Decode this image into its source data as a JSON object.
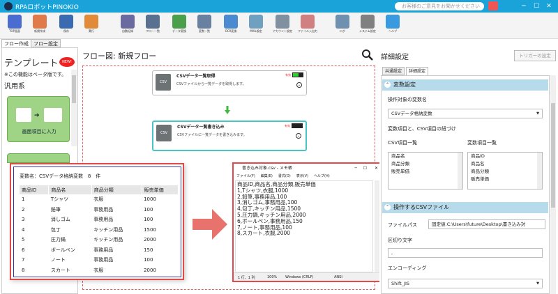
{
  "app": {
    "title": "RPAロボットPINOKIO",
    "feedback": "お客様のご意見をお聞かせください"
  },
  "toolbar": [
    {
      "label": "TOP画面",
      "icon": "home-icon",
      "color": "#4a6bd0"
    },
    {
      "label": "新規作成",
      "icon": "new-file-icon",
      "color": "#e07a4a"
    },
    {
      "label": "保存",
      "icon": "save-icon",
      "color": "#3a6ab0"
    },
    {
      "label": "実行",
      "icon": "run-icon",
      "color": "#e08a3a"
    },
    {
      "label": "自動記録",
      "icon": "record-icon",
      "color": "#6a6aa0"
    },
    {
      "label": "フロー一覧",
      "icon": "flow-list-icon",
      "color": "#5a7090"
    },
    {
      "label": "データ変換",
      "icon": "data-convert-icon",
      "color": "#4aa04a"
    },
    {
      "label": "変数一覧",
      "icon": "variable-list-icon",
      "color": "#6a80a0"
    },
    {
      "label": "OCR変換",
      "icon": "ocr-icon",
      "color": "#4a8ad0"
    },
    {
      "label": "MAIL設定",
      "icon": "mail-icon",
      "color": "#70a0c0"
    },
    {
      "label": "アカウント設定",
      "icon": "account-icon",
      "color": "#8090a0"
    },
    {
      "label": "ファイル入出力",
      "icon": "file-io-icon",
      "color": "#d08080"
    },
    {
      "label": "ログ",
      "icon": "log-icon",
      "color": "#7090b0"
    },
    {
      "label": "システム設定",
      "icon": "gear-icon",
      "color": "#808080"
    },
    {
      "label": "ヘルプ",
      "icon": "help-icon",
      "color": "#3a9ae0"
    }
  ],
  "tabs": [
    "フロー作成",
    "フロー設定"
  ],
  "left": {
    "title": "テンプレート",
    "badge": "NEW!",
    "beta": "※この機能はベータ版です。",
    "category": "汎用系",
    "card": "画面項目に入力"
  },
  "center": {
    "title": "フロー図:  新規フロー"
  },
  "nodes": [
    {
      "icon": "CSV",
      "title": "CSVデータ一覧取得",
      "desc": "CSVファイルから一覧データを取得します。",
      "enabled": "有効"
    },
    {
      "icon": "CSV",
      "title": "CSVデータ一覧書き込み",
      "desc": "CSVファイルに一覧データを書き込みます。",
      "enabled": "有効"
    }
  ],
  "var_popup": {
    "label": "変数名：",
    "name": "CSVデータ格納変数",
    "count": "8　件",
    "columns": [
      "商品ID",
      "商品名",
      "商品分類",
      "販売単価"
    ],
    "rows": [
      [
        "1",
        "Tシャツ",
        "衣服",
        "1000"
      ],
      [
        "2",
        "鉛筆",
        "事務用品",
        "100"
      ],
      [
        "3",
        "消しゴム",
        "事務用品",
        "100"
      ],
      [
        "4",
        "包丁",
        "キッチン用品",
        "1500"
      ],
      [
        "5",
        "圧力鍋",
        "キッチン用品",
        "2000"
      ],
      [
        "6",
        "ボールペン",
        "事務用品",
        "150"
      ],
      [
        "7",
        "ノート",
        "事務用品",
        "100"
      ],
      [
        "8",
        "スカート",
        "衣服",
        "2000"
      ]
    ]
  },
  "notepad": {
    "title": "書き込み対象.csv - メモ帳",
    "menu": [
      "ファイル(F)",
      "編集(E)",
      "書式(O)",
      "表示(V)",
      "ヘルプ(H)"
    ],
    "lines": [
      "商品ID,商品名,商品分類,販売単価",
      "1,Tシャツ,衣服,1000",
      "2,鉛筆,事務用品,100",
      "3,消しゴム,事務用品,100",
      "4,包丁,キッチン用品,1500",
      "5,圧力鍋,キッチン用品,2000",
      "6,ボールペン,事務用品,150",
      "7,ノート,事務用品,100",
      "8,スカート,衣服,2000"
    ],
    "status": {
      "pos": "1 行、1 列",
      "zoom": "100%",
      "eol": "Windows (CRLF)",
      "enc": "ANSI"
    }
  },
  "right": {
    "title": "詳細設定",
    "trigger": "トリガーの設定",
    "tabs": [
      "共通設定",
      "詳細設定"
    ],
    "var_section": "変数設定",
    "target_var_label": "操作対象の変数名",
    "target_var": "CSVデータ格納変数",
    "link_label": "変数項目と、CSV項目の紐づけ",
    "csv_items_label": "CSV項目一覧",
    "csv_items": [
      "商品名",
      "商品分類",
      "販売単価"
    ],
    "var_items_label": "変数項目一覧",
    "var_items": [
      "商品ID",
      "商品名",
      "商品分類",
      "販売単価"
    ],
    "file_section": "操作するCSVファイル",
    "path_label": "ファイルパス",
    "path": "固定値:C:\\Users\\future\\Desktop\\書き込み対",
    "delim_label": "区切り文字",
    "delim": ",",
    "enc_label": "エンコーディング",
    "enc": "Shift_JIS"
  }
}
